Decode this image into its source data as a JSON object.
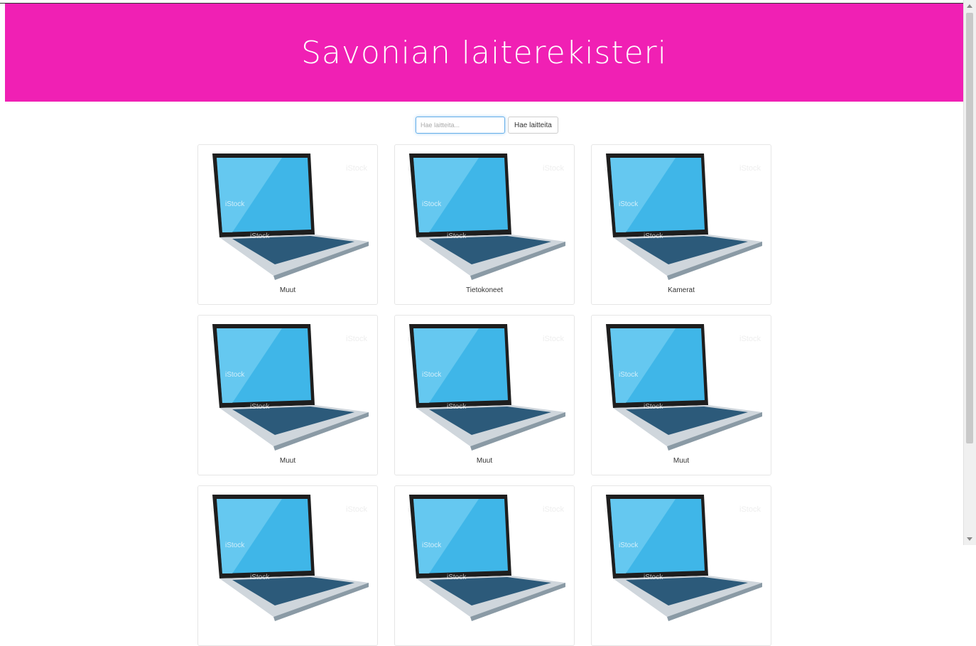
{
  "header": {
    "title": "Savonian laiterekisteri"
  },
  "search": {
    "placeholder": "Hae laitteita...",
    "button_label": "Hae laitteita"
  },
  "colors": {
    "header_bg": "#f020b4",
    "screen": "#3fb6e8"
  },
  "devices": [
    {
      "label": "Muut",
      "icon": "laptop-image"
    },
    {
      "label": "Tietokoneet",
      "icon": "laptop-image"
    },
    {
      "label": "Kamerat",
      "icon": "laptop-image"
    },
    {
      "label": "Muut",
      "icon": "laptop-image"
    },
    {
      "label": "Muut",
      "icon": "laptop-image"
    },
    {
      "label": "Muut",
      "icon": "laptop-image"
    },
    {
      "label": "",
      "icon": "laptop-image"
    },
    {
      "label": "",
      "icon": "laptop-image"
    },
    {
      "label": "",
      "icon": "laptop-image"
    }
  ]
}
